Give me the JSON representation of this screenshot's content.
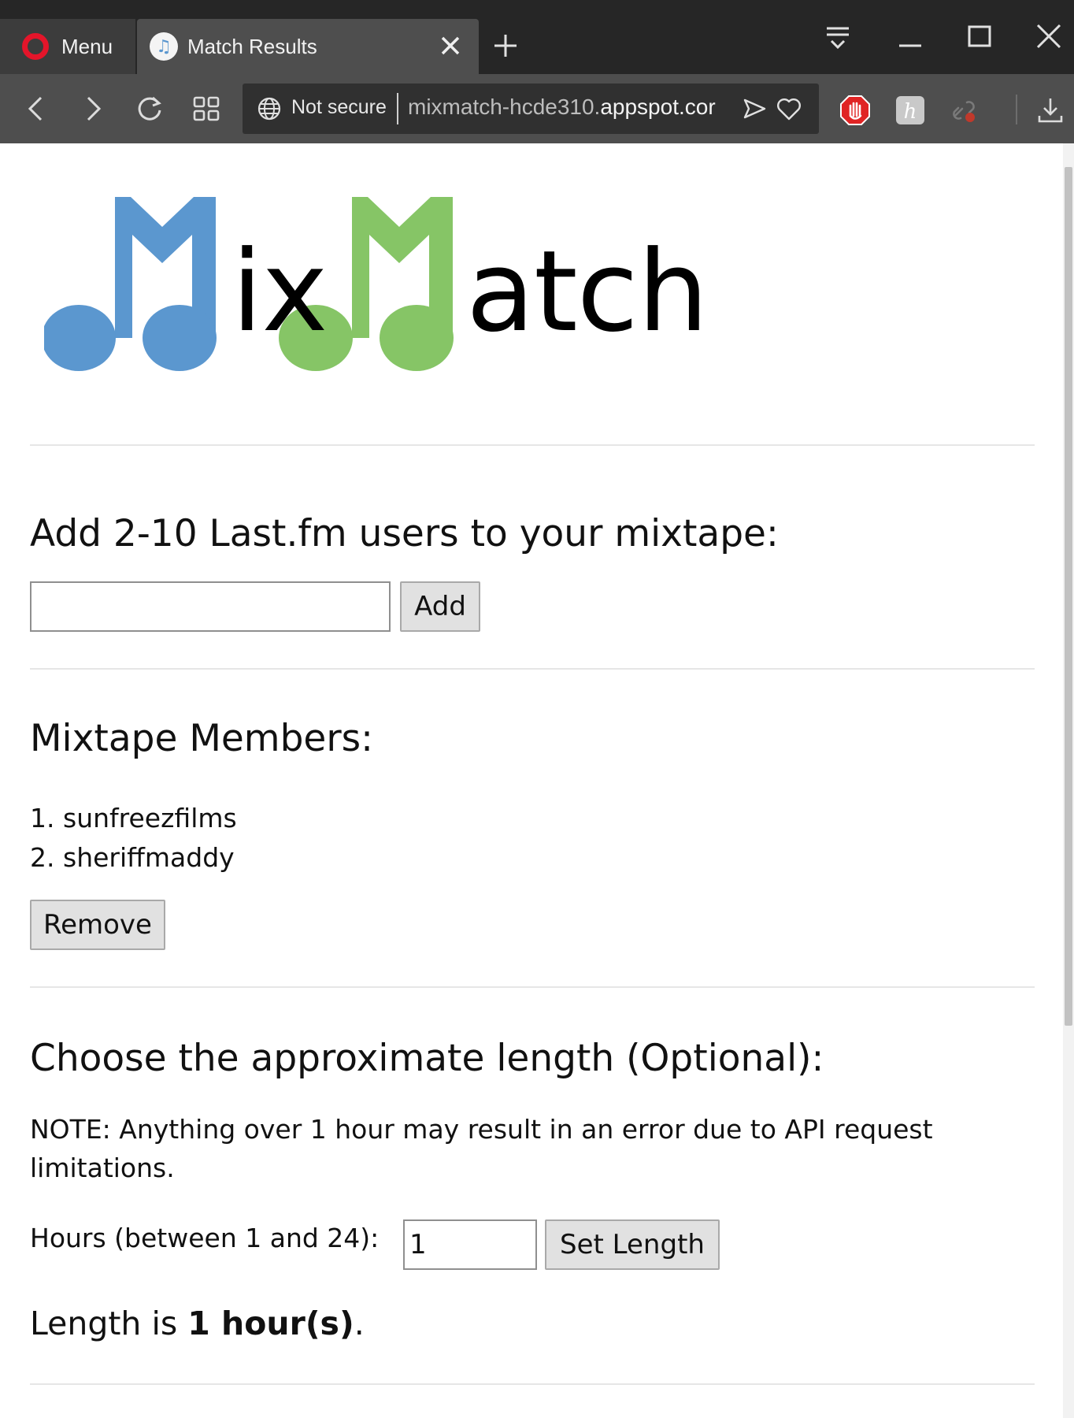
{
  "browser": {
    "menu_label": "Menu",
    "tab_title": "Match Results",
    "security_label": "Not secure",
    "url_prefix": "mixmatch-hcde310.",
    "url_host": "appspot.cor"
  },
  "logo": {
    "text_1": "ix",
    "text_2": "atch",
    "note_colors": {
      "first": "#5b97cf",
      "second": "#86c566"
    }
  },
  "add_section": {
    "heading": "Add 2-10 Last.fm users to your mixtape:",
    "input_value": "",
    "add_button": "Add"
  },
  "members_section": {
    "heading": "Mixtape Members:",
    "members": [
      {
        "index": "1.",
        "name": "sunfreezfilms"
      },
      {
        "index": "2.",
        "name": "sheriffmaddy"
      }
    ],
    "remove_button": "Remove"
  },
  "length_section": {
    "heading": "Choose the approximate length (Optional):",
    "note_line_1": "NOTE: Anything over 1 hour may result in an error due to API request",
    "note_line_2": "limitations.",
    "hours_label": "Hours (between 1 and 24):",
    "hours_value": "1",
    "set_button": "Set Length",
    "length_prefix": "Length is ",
    "length_value": "1 hour(s)",
    "length_suffix": "."
  },
  "colors": {
    "chrome_dark": "#262626",
    "chrome_mid": "#4e4e4e",
    "opera_red": "#e4152a",
    "adblock_red": "#e02424"
  }
}
